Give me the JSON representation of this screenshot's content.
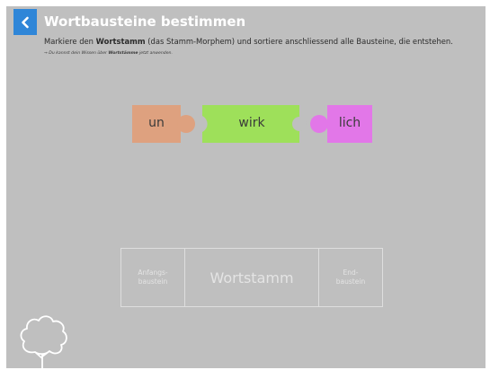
{
  "header": {
    "title": "Wortbausteine bestimmen",
    "back_icon": "chevron-left-icon"
  },
  "instruction": {
    "before": "Markiere den ",
    "bold": "Wortstamm",
    "after": " (das Stamm-Morphem) und sortiere anschliessend alle Bausteine, die entstehen."
  },
  "hint": {
    "before": "→ Du kannst dein Wissen über ",
    "bold": "Wortstämme",
    "after": " jetzt anwenden."
  },
  "pieces": [
    {
      "label": "un",
      "color": "#dea17f"
    },
    {
      "label": "wirk",
      "color": "#9ee05a"
    },
    {
      "label": "lich",
      "color": "#e277e8"
    }
  ],
  "dropzones": {
    "prefix": {
      "line1": "Anfangs-",
      "line2": "baustein"
    },
    "stem": "Wortstamm",
    "suffix": {
      "line1": "End-",
      "line2": "baustein"
    }
  },
  "colors": {
    "background": "#bfbfbf",
    "accent": "#2f86d8"
  },
  "decoration": "tree-icon"
}
